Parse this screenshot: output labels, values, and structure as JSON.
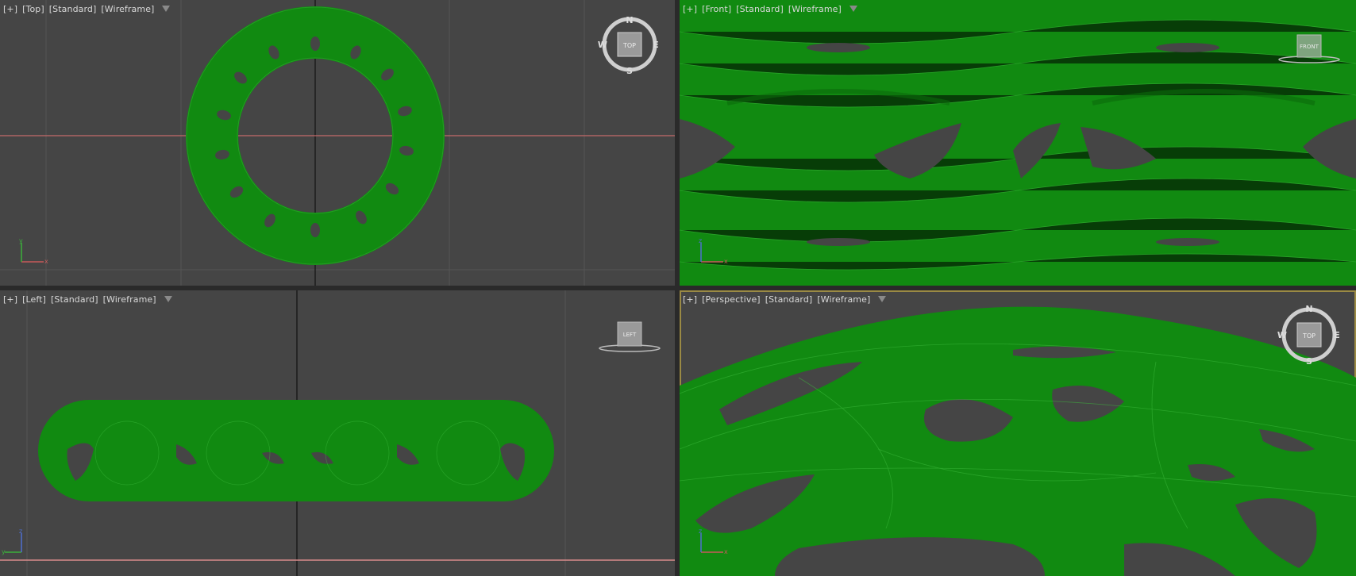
{
  "viewports": {
    "top": {
      "plus": "[+]",
      "view": "[Top]",
      "shading_mode": "[Standard]",
      "render_mode": "[Wireframe]",
      "viewcube_face": "TOP",
      "compass": {
        "n": "N",
        "s": "S",
        "e": "E",
        "w": "W"
      }
    },
    "front": {
      "plus": "[+]",
      "view": "[Front]",
      "shading_mode": "[Standard]",
      "render_mode": "[Wireframe]",
      "viewcube_face": "FRONT"
    },
    "left": {
      "plus": "[+]",
      "view": "[Left]",
      "shading_mode": "[Standard]",
      "render_mode": "[Wireframe]",
      "viewcube_face": "LEFT"
    },
    "perspective": {
      "plus": "[+]",
      "view": "[Perspective]",
      "shading_mode": "[Standard]",
      "render_mode": "[Wireframe]",
      "viewcube_face": "TOP",
      "compass": {
        "n": "N",
        "s": "S",
        "e": "E",
        "w": "W"
      }
    }
  },
  "colors": {
    "background": "#454545",
    "grid": "#525252",
    "mesh_green": "#118a11",
    "mesh_line": "#3dbb3d",
    "axis_red": "#c85a5a",
    "axis_green": "#3bb03b",
    "axis_blue": "#4f6fd0",
    "active_border": "#9a8a44"
  },
  "icons": {
    "filter": "funnel-icon",
    "viewcube": "viewcube-icon",
    "compass": "compass-ring-icon",
    "axis_tripod": "axis-tripod-icon"
  },
  "axes": {
    "top": {
      "a": "x",
      "b": "y"
    },
    "front": {
      "a": "x",
      "b": "z"
    },
    "left": {
      "a": "y",
      "b": "z"
    },
    "perspective": {
      "a": "x",
      "b": "z"
    }
  }
}
